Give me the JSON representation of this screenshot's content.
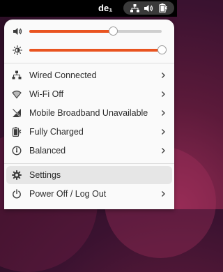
{
  "topbar": {
    "label": "de₁",
    "indicators": [
      "network-wired-icon",
      "volume-icon",
      "battery-icon"
    ]
  },
  "sliders": {
    "volume": {
      "icon": "volume-icon",
      "level": 0.63
    },
    "brightness": {
      "icon": "brightness-icon",
      "level": 1.0
    }
  },
  "menu": {
    "items": [
      {
        "label": "Wired Connected",
        "icon": "network-wired-icon",
        "submenu": true
      },
      {
        "label": "Wi-Fi Off",
        "icon": "wifi-icon",
        "submenu": true
      },
      {
        "label": "Mobile Broadband Unavailable",
        "icon": "mobile-signal-off-icon",
        "submenu": true
      },
      {
        "label": "Fully Charged",
        "icon": "battery-full-charged-icon",
        "submenu": true
      },
      {
        "label": "Balanced",
        "icon": "power-profile-icon",
        "submenu": true
      }
    ],
    "settings_label": "Settings",
    "power_label": "Power Off / Log Out"
  },
  "colors": {
    "accent": "#e95420",
    "panel": "#fafafa",
    "hover": "#e6e6e6",
    "topbar": "#000000"
  }
}
